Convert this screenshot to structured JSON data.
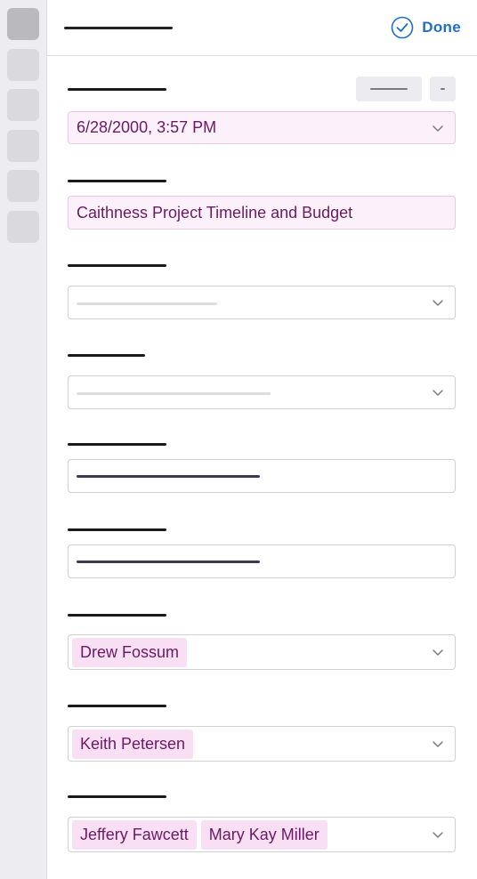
{
  "header": {
    "done_label": "Done"
  },
  "fields": {
    "date": {
      "value": "6/28/2000, 3:57 PM"
    },
    "title": {
      "value": "Caithness Project Timeline and Budget"
    },
    "assignee": {
      "chips": [
        "Drew Fossum"
      ]
    },
    "owner": {
      "chips": [
        "Keith Petersen"
      ]
    },
    "reviewers": {
      "chips": [
        "Jeffery Fawcett",
        "Mary Kay Miller"
      ]
    }
  },
  "icons": {
    "done": "check-circle-icon",
    "dropdown": "chevron-down-icon"
  },
  "colors": {
    "accent": "#1f6fc7",
    "field_text": "#6b1a62",
    "chip_bg": "#f8dff4",
    "highlight_field_bg": "#fcf1fa"
  }
}
